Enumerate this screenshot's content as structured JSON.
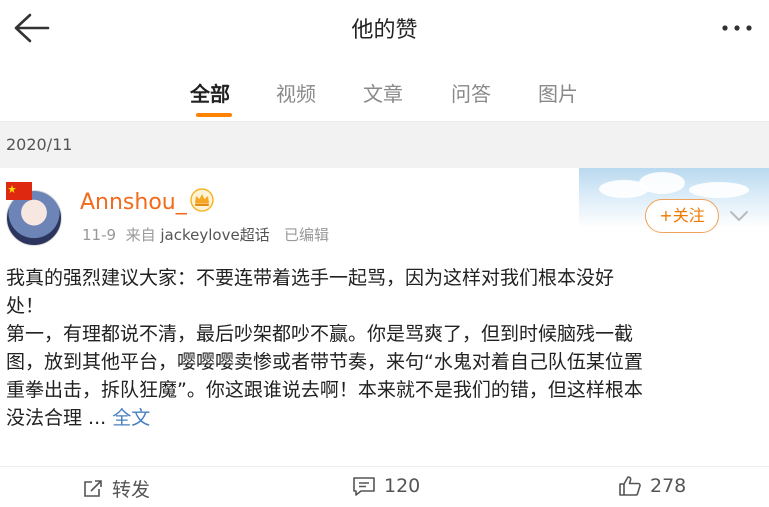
{
  "header": {
    "title": "他的赞",
    "back_icon": "arrow-left-icon",
    "more_icon": "more-dots-icon"
  },
  "tabs": [
    {
      "label": "全部",
      "active": true
    },
    {
      "label": "视频",
      "active": false
    },
    {
      "label": "文章",
      "active": false
    },
    {
      "label": "问答",
      "active": false
    },
    {
      "label": "图片",
      "active": false
    }
  ],
  "colors": {
    "accent": "#ff8200",
    "username": "#f26a1b",
    "link": "#4a7fc1"
  },
  "date_label": "2020/11",
  "post": {
    "username": "Annshou_",
    "date": "11-9",
    "source_prefix": "来自",
    "source": "jackeylove超话",
    "edited": "已编辑",
    "follow_label": "+关注",
    "lines": [
      "我真的强烈建议大家：不要连带着选手一起骂，因为这样对我们根本没好",
      "处！",
      "第一，有理都说不清，最后吵架都吵不赢。你是骂爽了，但到时候脑残一截",
      "图，放到其他平台，嘤嘤嘤卖惨或者带节奏，来句“水鬼对着自己队伍某位置",
      "重拳出击，拆队狂魔”。你这跟谁说去啊！本来就不是我们的错，但这样根本",
      "没法合理 ..."
    ],
    "expand_label": "全文",
    "actions": {
      "repost": "转发",
      "comments": "120",
      "likes": "278"
    }
  }
}
